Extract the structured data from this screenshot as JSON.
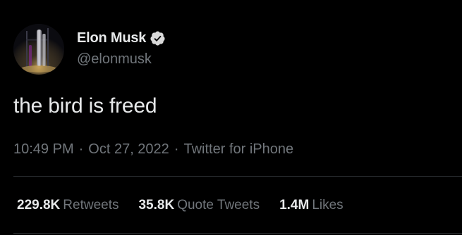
{
  "author": {
    "display_name": "Elon Musk",
    "handle": "@elonmusk",
    "verified_badge_icon": "verified-badge-icon",
    "avatar_icon": "avatar-image"
  },
  "tweet": {
    "text": "the bird is freed",
    "time": "10:49 PM",
    "separator_1": "·",
    "date": "Oct 27, 2022",
    "separator_2": "·",
    "source": "Twitter for iPhone"
  },
  "stats": {
    "retweets": {
      "count": "229.8K",
      "label": "Retweets"
    },
    "quote_tweets": {
      "count": "35.8K",
      "label": "Quote Tweets"
    },
    "likes": {
      "count": "1.4M",
      "label": "Likes"
    }
  },
  "colors": {
    "background": "#000000",
    "primary_text": "#e7e9ea",
    "secondary_text": "#71767b",
    "divider": "#2f3336",
    "badge": "#d9d9d9"
  }
}
